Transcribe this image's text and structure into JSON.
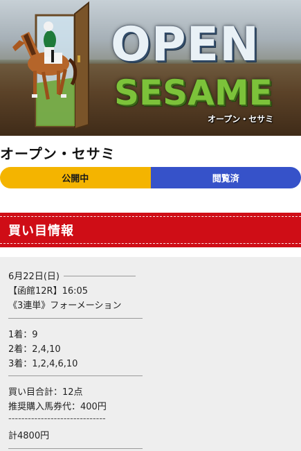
{
  "hero": {
    "open_word": "OPEN",
    "sesame_word": "SESAME",
    "subtitle": "オープン・セサミ"
  },
  "page_title": "オープン・セサミ",
  "status": {
    "left": "公開中",
    "right": "閲覧済"
  },
  "section_title": "買い目情報",
  "info": {
    "date": "6月22日(日)",
    "race": "【函館12R】16:05",
    "bet_type": "《3連単》フォーメーション",
    "pos1": "1着：9",
    "pos2": "2着：2,4,10",
    "pos3": "3着：1,2,4,6,10",
    "total_points": "買い目合計：12点",
    "recommended": "推奨購入馬券代：400円",
    "separator": "------------------------------",
    "total": "計4800円"
  },
  "colors": {
    "status_open": "#f4b400",
    "status_viewed": "#3652c9",
    "section_red": "#cf0d16",
    "info_bg": "#eeeeee"
  }
}
